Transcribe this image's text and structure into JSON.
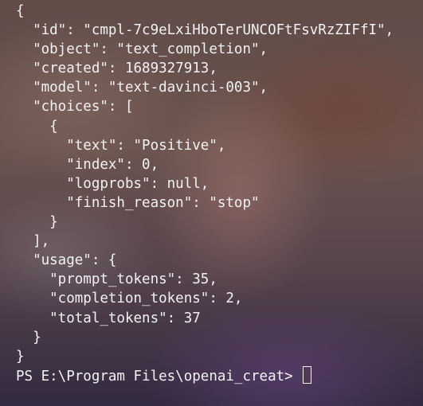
{
  "terminal": {
    "lines": [
      "{",
      "  \"id\": \"cmpl-7c9eLxiHboTerUNCOFtFsvRzZIFfI\",",
      "  \"object\": \"text_completion\",",
      "  \"created\": 1689327913,",
      "  \"model\": \"text-davinci-003\",",
      "  \"choices\": [",
      "    {",
      "      \"text\": \"Positive\",",
      "      \"index\": 0,",
      "      \"logprobs\": null,",
      "      \"finish_reason\": \"stop\"",
      "    }",
      "  ],",
      "  \"usage\": {",
      "    \"prompt_tokens\": 35,",
      "    \"completion_tokens\": 2,",
      "    \"total_tokens\": 37",
      "  }",
      "}"
    ],
    "prompt": "PS E:\\Program Files\\openai_creat> "
  }
}
